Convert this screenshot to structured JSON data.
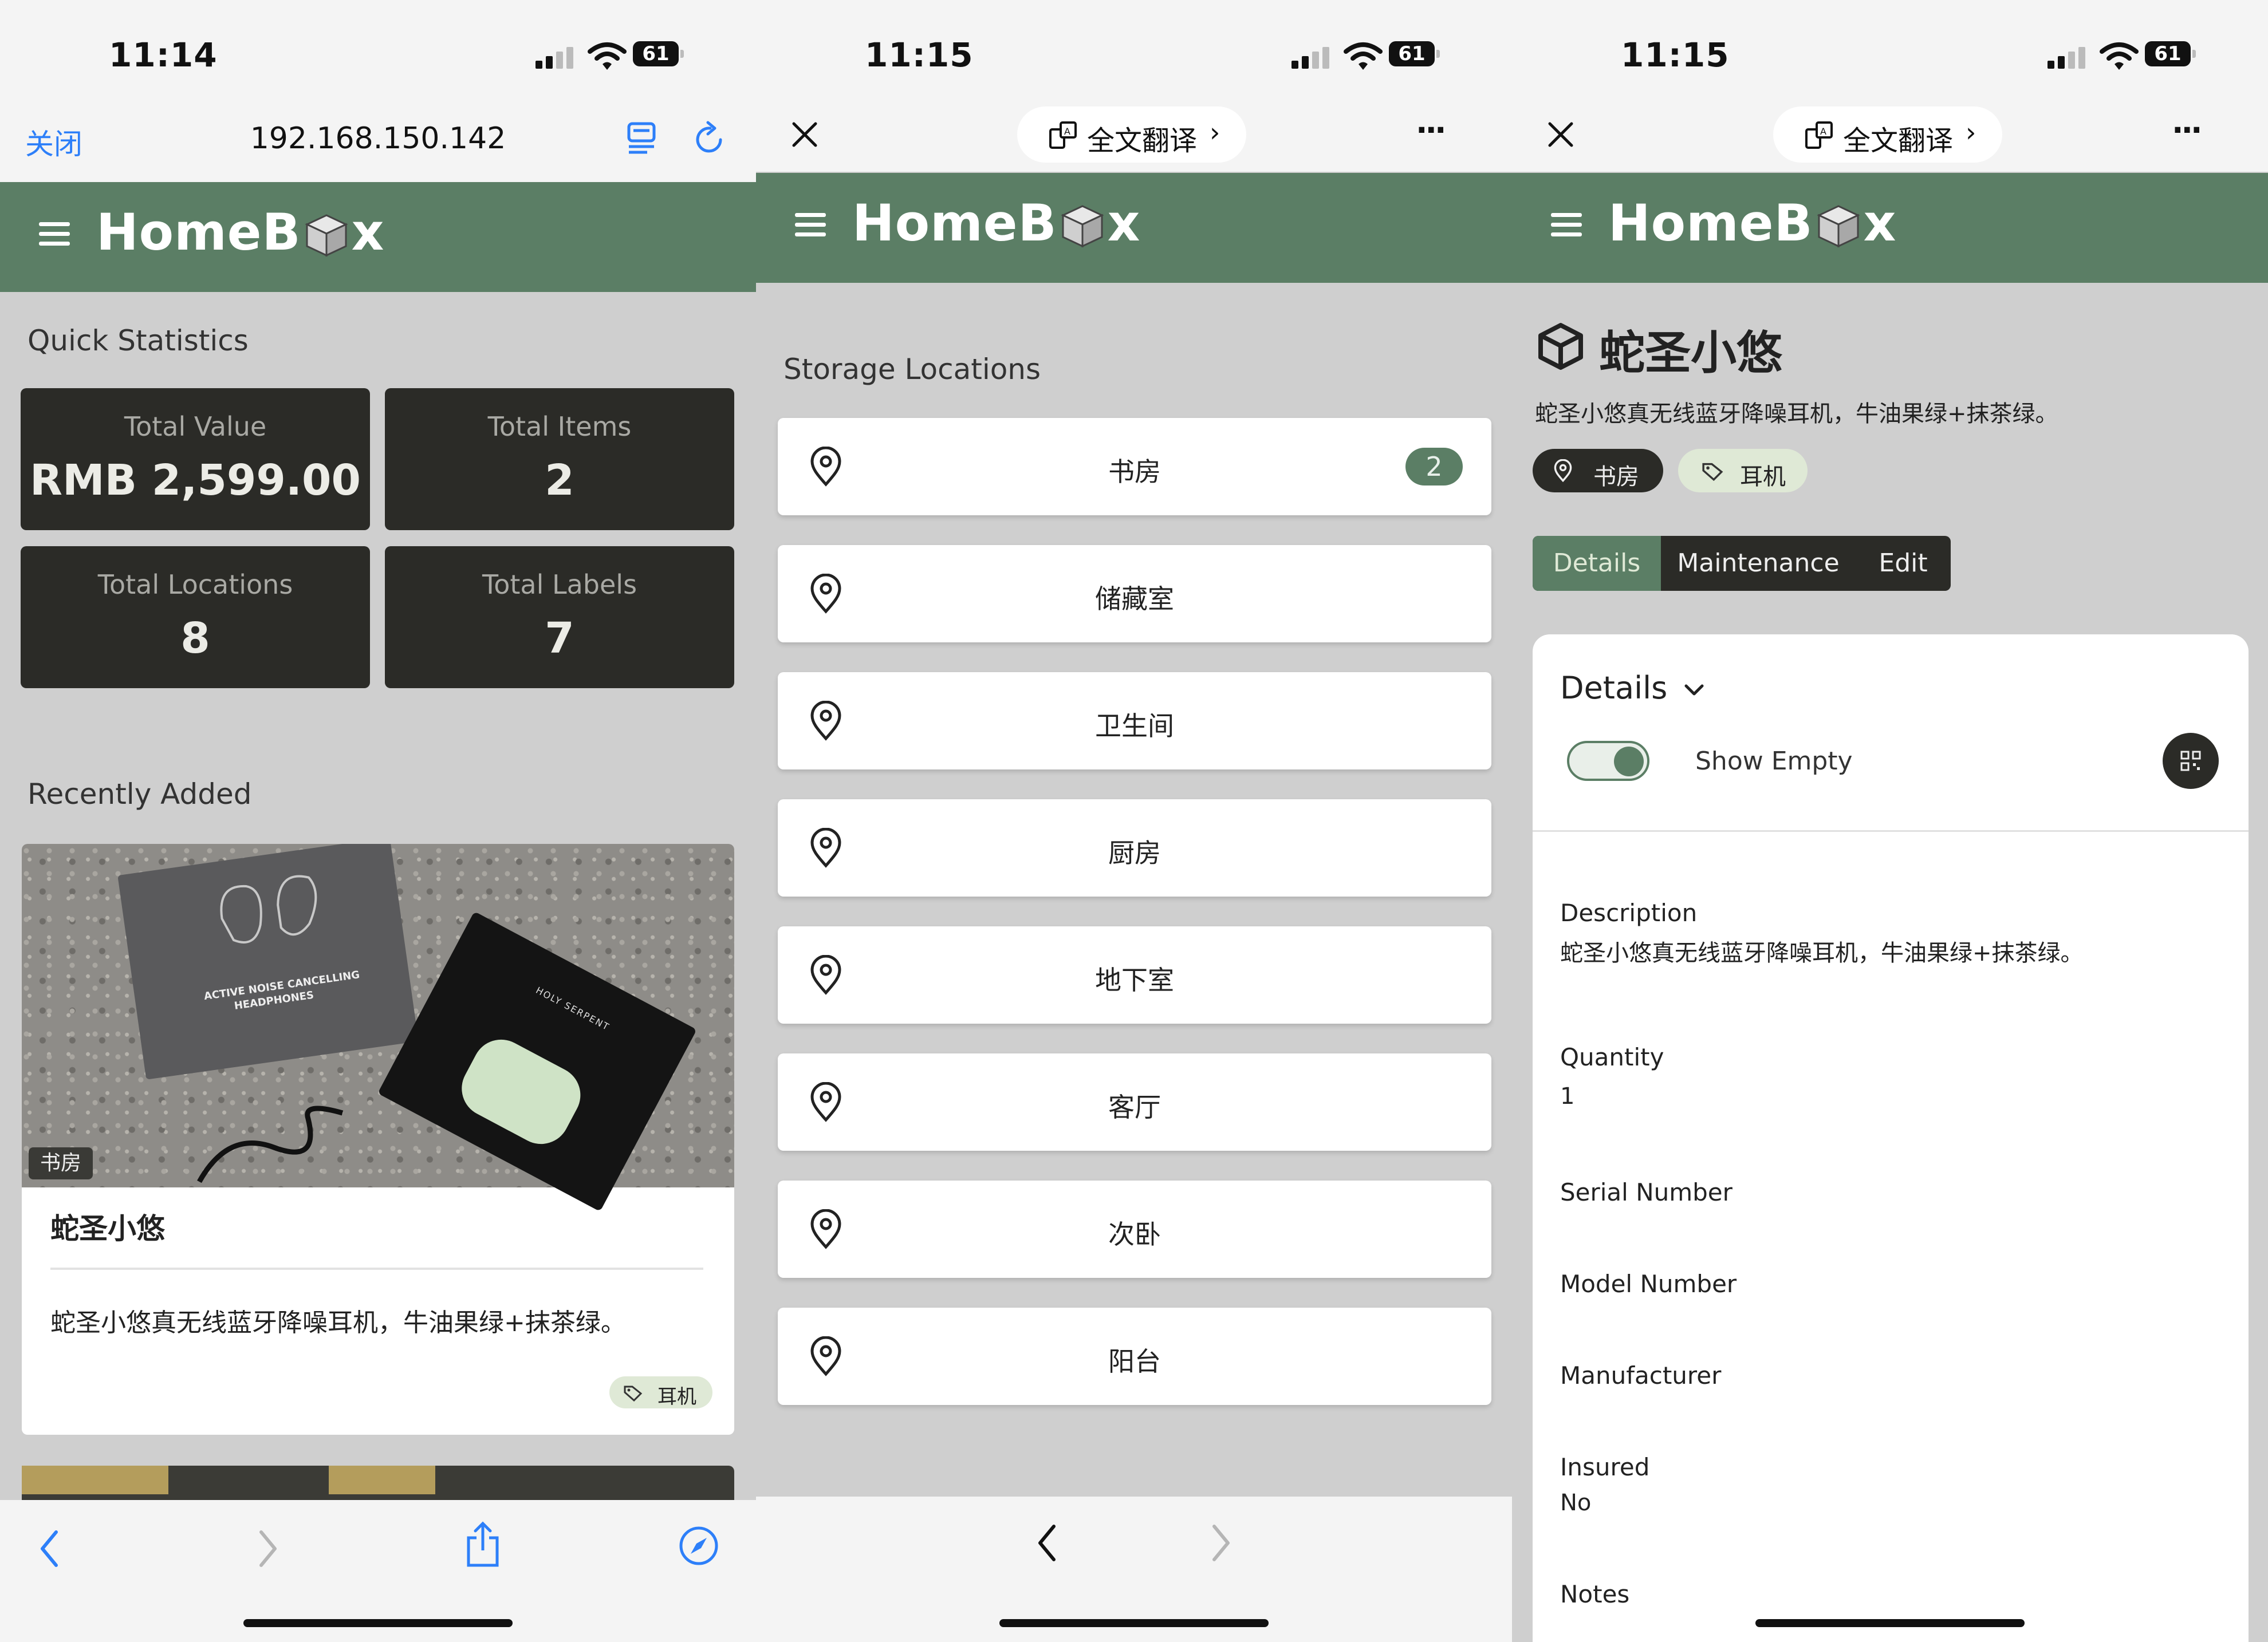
{
  "status_bar": {
    "time_1": "11:14",
    "time_2": "11:15",
    "time_3": "11:15",
    "battery": "61"
  },
  "browser1": {
    "close": "关闭",
    "url": "192.168.150.142"
  },
  "browser2": {
    "translate": "全文翻译",
    "more": "···"
  },
  "app": {
    "logo_left": "HomeB",
    "logo_right": "x"
  },
  "dashboard": {
    "quick_stats_title": "Quick Statistics",
    "stats": [
      {
        "label": "Total Value",
        "value": "RMB 2,599.00"
      },
      {
        "label": "Total Items",
        "value": "2"
      },
      {
        "label": "Total Locations",
        "value": "8"
      },
      {
        "label": "Total Labels",
        "value": "7"
      }
    ],
    "recent_title": "Recently Added",
    "card": {
      "location_tag": "书房",
      "image_text_1": "ACTIVE NOISE CANCELLING",
      "image_text_2": "HEADPHONES",
      "image_text_3": "HOLY SERPENT",
      "title": "蛇圣小悠",
      "description": "蛇圣小悠真无线蓝牙降噪耳机，牛油果绿+抹茶绿。",
      "label": "耳机"
    }
  },
  "locations": {
    "title": "Storage Locations",
    "items": [
      {
        "name": "书房",
        "count": "2"
      },
      {
        "name": "储藏室"
      },
      {
        "name": "卫生间"
      },
      {
        "name": "厨房"
      },
      {
        "name": "地下室"
      },
      {
        "name": "客厅"
      },
      {
        "name": "次卧"
      },
      {
        "name": "阳台"
      }
    ]
  },
  "item": {
    "title": "蛇圣小悠",
    "subtitle": "蛇圣小悠真无线蓝牙降噪耳机，牛油果绿+抹茶绿。",
    "chip_location": "书房",
    "chip_label": "耳机",
    "tabs": [
      "Details",
      "Maintenance",
      "Edit"
    ],
    "details_header": "Details",
    "show_empty": "Show Empty",
    "fields": [
      {
        "label": "Description",
        "value": "蛇圣小悠真无线蓝牙降噪耳机，牛油果绿+抹茶绿。"
      },
      {
        "label": "Quantity",
        "value": "1"
      },
      {
        "label": "Serial Number",
        "value": ""
      },
      {
        "label": "Model Number",
        "value": ""
      },
      {
        "label": "Manufacturer",
        "value": ""
      },
      {
        "label": "Insured",
        "value": "No"
      },
      {
        "label": "Notes",
        "value": ""
      }
    ]
  },
  "colors": {
    "accent": "#5b7e65",
    "dark_card": "#2b2b27",
    "label_chip": "#dfe9d6",
    "ios_blue": "#2d7ff9"
  }
}
